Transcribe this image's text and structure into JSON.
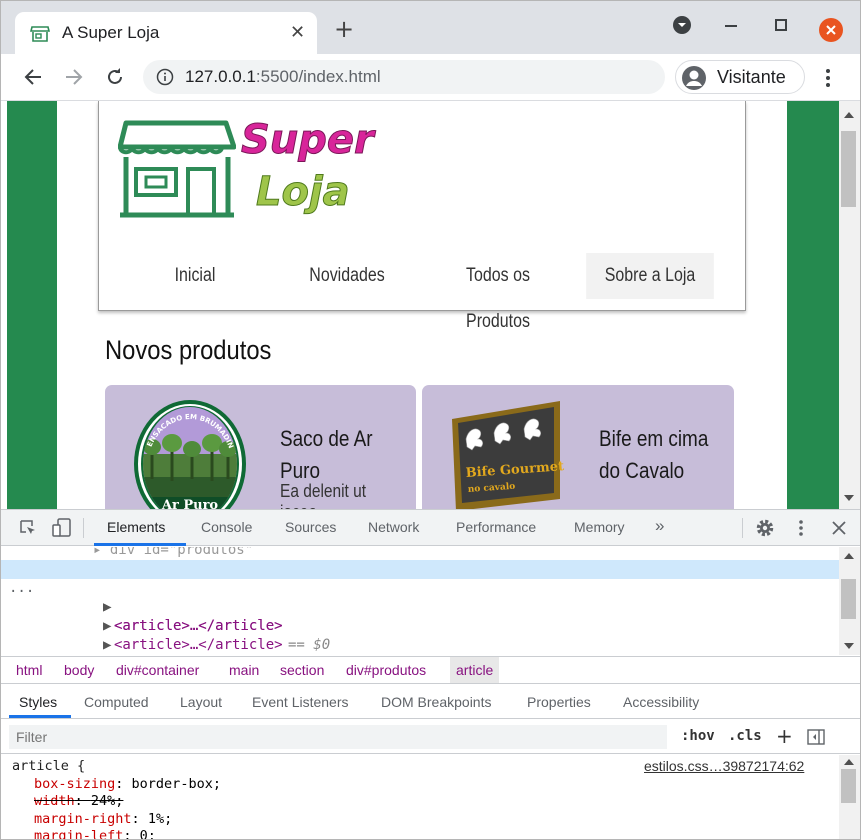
{
  "browser": {
    "tab_title": "A Super Loja",
    "tab_close": "✕",
    "new_tab": "+",
    "url_host": "127.0.0.1",
    "url_rest": ":5500/index.html",
    "profile_name": "Visitante"
  },
  "page": {
    "logo_word1": "Super",
    "logo_word2": "Loja",
    "nav": [
      "Inicial",
      "Novidades",
      "Todos os Produtos",
      "Sobre a Loja"
    ],
    "active_nav": "Sobre a Loja",
    "section_title": "Novos produtos",
    "products": [
      {
        "name": "Saco de Ar Puro",
        "desc": "Ea delenit ut iaceo",
        "badge": "ENSACADO EM BRUMADINHO",
        "label": "Ar Puro"
      },
      {
        "name_line1": "Bife em cima",
        "name_line2": "do Cavalo",
        "board_title": "Bife Gourmet",
        "board_sub": "no cavalo"
      }
    ]
  },
  "devtools": {
    "tabs": [
      "Elements",
      "Console",
      "Sources",
      "Network",
      "Performance",
      "Memory"
    ],
    "more": "»",
    "elements": {
      "ellipsis": "...",
      "selected_suffix": "== $0",
      "row_text": "<article>…</article>"
    },
    "breadcrumb": [
      "html",
      "body",
      "div#container",
      "main",
      "section",
      "div#produtos",
      "article"
    ],
    "subtabs": [
      "Styles",
      "Computed",
      "Layout",
      "Event Listeners",
      "DOM Breakpoints",
      "Properties",
      "Accessibility"
    ],
    "filter_placeholder": "Filter",
    "hov": ":hov",
    "cls": ".cls",
    "plus": "+",
    "rule": {
      "selector": "article {",
      "source": "estilos.css…39872174:62",
      "decls": [
        {
          "prop": "box-sizing",
          "value": "border-box;",
          "strike": false
        },
        {
          "prop": "width",
          "value": "24%;",
          "strike": true
        },
        {
          "prop": "margin-right",
          "value": "1%;",
          "strike": false
        },
        {
          "prop": "margin-left",
          "value": "0;",
          "strike": false
        }
      ]
    }
  }
}
